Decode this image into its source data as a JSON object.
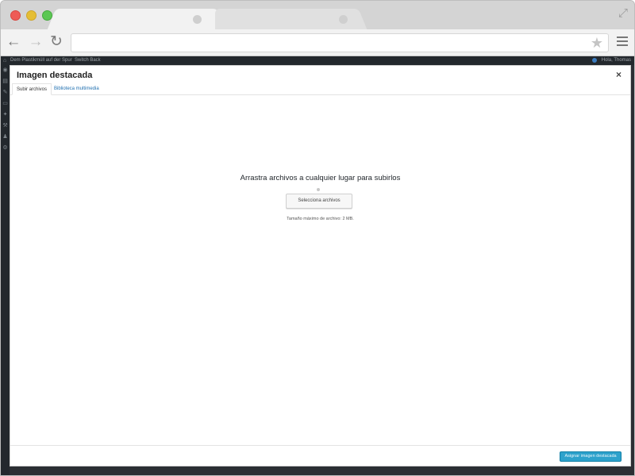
{
  "browser": {
    "url": "",
    "icons": {
      "back": "arrow-left-icon",
      "forward": "arrow-right-icon",
      "reload": "reload-icon",
      "bookmark": "star-icon",
      "menu": "hamburger-menu-icon",
      "fullscreen": "expand-icon"
    }
  },
  "admin_bar": {
    "site_name": "Dem Plastikmüll auf der Spur",
    "switch_back": "Switch Back",
    "greeting": "Hola, Thomas"
  },
  "modal": {
    "title": "Imagen destacada",
    "tabs": [
      {
        "label": "Subir archivos",
        "active": true
      },
      {
        "label": "Biblioteca multimedia",
        "active": false
      }
    ],
    "upload": {
      "instructions": "Arrastra archivos a cualquier lugar para subirlos",
      "select_button": "Selecciona archivos",
      "max_size": "Tamaño máximo de archivo: 2 MB."
    },
    "footer_button": "Asignar imagen destacada"
  },
  "colors": {
    "accent": "#2ea2cc",
    "link": "#2271b1",
    "admin_bar": "#23282d"
  }
}
